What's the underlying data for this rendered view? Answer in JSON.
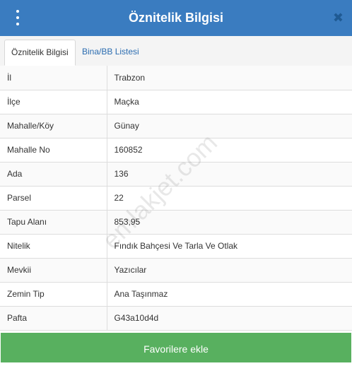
{
  "header": {
    "title": "Öznitelik Bilgisi",
    "menu_icon": "vertical-dots-icon",
    "close_icon": "close-icon",
    "close_glyph": "✖"
  },
  "tabs": [
    {
      "label": "Öznitelik Bilgisi",
      "active": true
    },
    {
      "label": "Bina/BB Listesi",
      "active": false
    }
  ],
  "rows": [
    {
      "key": "İl",
      "value": "Trabzon"
    },
    {
      "key": "İlçe",
      "value": "Maçka"
    },
    {
      "key": "Mahalle/Köy",
      "value": "Günay"
    },
    {
      "key": "Mahalle No",
      "value": "160852"
    },
    {
      "key": "Ada",
      "value": "136"
    },
    {
      "key": "Parsel",
      "value": "22"
    },
    {
      "key": "Tapu Alanı",
      "value": "853,95"
    },
    {
      "key": "Nitelik",
      "value": "Fındık Bahçesi Ve Tarla Ve Otlak"
    },
    {
      "key": "Mevkii",
      "value": "Yazıcılar"
    },
    {
      "key": "Zemin Tip",
      "value": "Ana Taşınmaz"
    },
    {
      "key": "Pafta",
      "value": "G43a10d4d"
    }
  ],
  "watermark": "emlakjet.com",
  "footer": {
    "button_label": "Favorilere ekle"
  },
  "colors": {
    "header": "#3a7cc0",
    "footer": "#58b05f",
    "tab_link": "#2b6cb0"
  }
}
